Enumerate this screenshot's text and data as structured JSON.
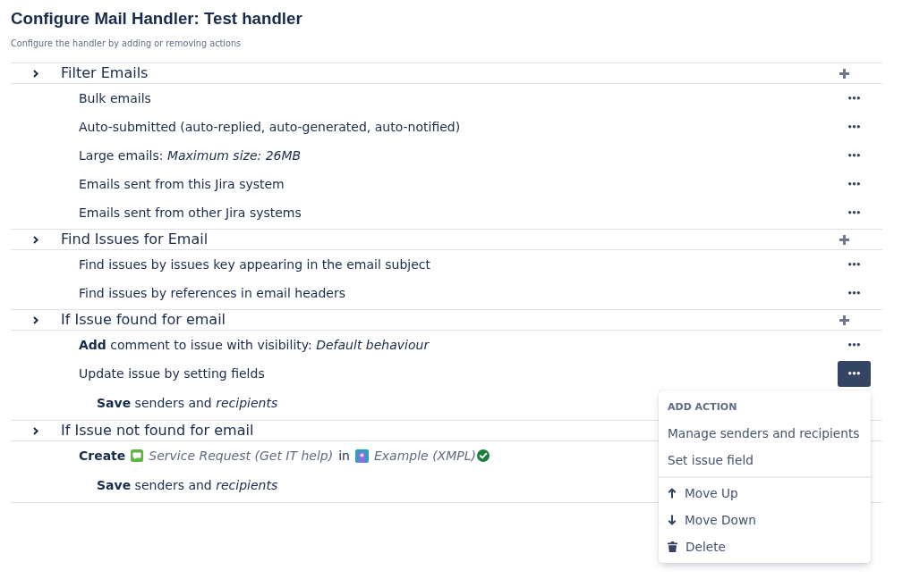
{
  "page": {
    "title": "Configure Mail Handler: Test handler",
    "description": "Configure the handler by adding or removing actions"
  },
  "sections": [
    {
      "title": "Filter Emails",
      "add_button": true,
      "actions": [
        {
          "kind": "text",
          "text": "Bulk emails",
          "more_button": true,
          "menu_open": false
        },
        {
          "kind": "text",
          "text": "Auto-submitted (auto-replied, auto-generated, auto-notified)",
          "more_button": true,
          "menu_open": false
        },
        {
          "kind": "text",
          "text": "Large emails: *Maximum size: 26MB*",
          "more_button": true,
          "menu_open": false
        },
        {
          "kind": "text",
          "text": "Emails sent from this Jira system",
          "more_button": true,
          "menu_open": false
        },
        {
          "kind": "text",
          "text": "Emails sent from other Jira systems",
          "more_button": true,
          "menu_open": false
        }
      ]
    },
    {
      "title": "Find Issues for Email",
      "add_button": true,
      "actions": [
        {
          "kind": "text",
          "text": "Find issues by issues key appearing in the email subject",
          "more_button": true,
          "menu_open": false
        },
        {
          "kind": "text",
          "text": "Find issues by references in email headers",
          "more_button": true,
          "menu_open": false
        }
      ]
    },
    {
      "title": "If Issue found for email",
      "add_button": true,
      "actions": [
        {
          "kind": "text",
          "text": "**Add** comment to issue with visibility: *Default behaviour*",
          "more_button": true,
          "menu_open": false
        },
        {
          "kind": "text",
          "text": "Update issue by setting fields",
          "more_button": true,
          "menu_open": true,
          "children": [
            {
              "kind": "text",
              "text": "**Save** senders and *recipients*",
              "more_button": false
            }
          ]
        }
      ]
    },
    {
      "title": "If Issue not found for email",
      "add_button": false,
      "actions": [
        {
          "kind": "create",
          "verb": "Create",
          "request_type": "Service Request (Get IT help)",
          "connector": "in",
          "project": "Example (XMPL)",
          "project_verified": true,
          "more_button": false,
          "children": [
            {
              "kind": "text",
              "text": "**Save** senders and *recipients*",
              "more_button": false
            }
          ]
        }
      ]
    }
  ],
  "action_menu": {
    "groups": [
      {
        "heading": "ADD ACTION",
        "items": [
          {
            "kind": "option",
            "label": "Manage senders and recipients"
          },
          {
            "kind": "option",
            "label": "Set issue field"
          }
        ]
      },
      {
        "items": [
          {
            "kind": "move-up",
            "label": "Move Up"
          },
          {
            "kind": "move-down",
            "label": "Move Down"
          },
          {
            "kind": "delete",
            "label": "Delete"
          }
        ]
      }
    ]
  }
}
